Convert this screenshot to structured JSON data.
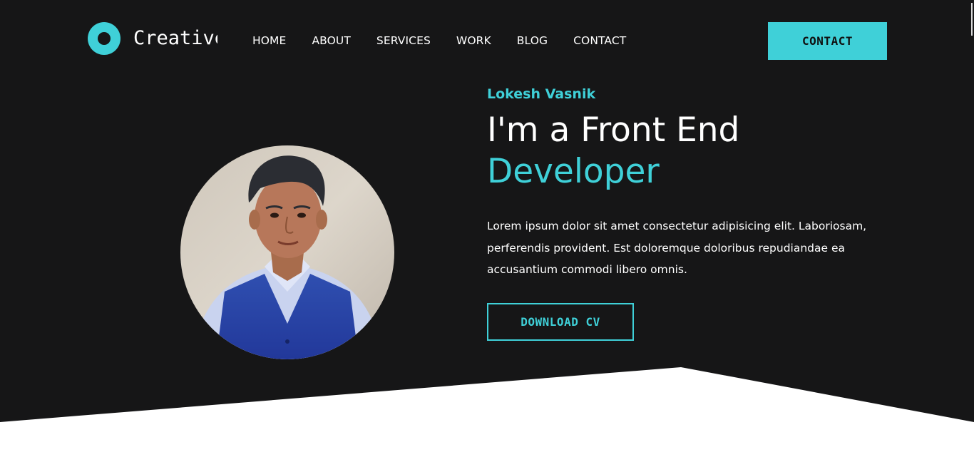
{
  "header": {
    "logo_text": "Creative",
    "nav": [
      "HOME",
      "ABOUT",
      "SERVICES",
      "WORK",
      "BLOG",
      "CONTACT"
    ],
    "contact_button": "CONTACT"
  },
  "hero": {
    "name": "Lokesh Vasnik",
    "title_line1": "I'm a Front End",
    "title_line2": "Developer",
    "description": "Lorem ipsum dolor sit amet consectetur adipisicing elit. Laboriosam, perferendis provident. Est doloremque doloribus repudiandae ea accusantium commodi libero omnis.",
    "cv_button": "DOWNLOAD CV",
    "avatar_icon": "profile-photo"
  },
  "colors": {
    "background": "#161617",
    "accent": "#3fd0d8",
    "text": "#ffffff",
    "lower_section": "#ffffff"
  }
}
